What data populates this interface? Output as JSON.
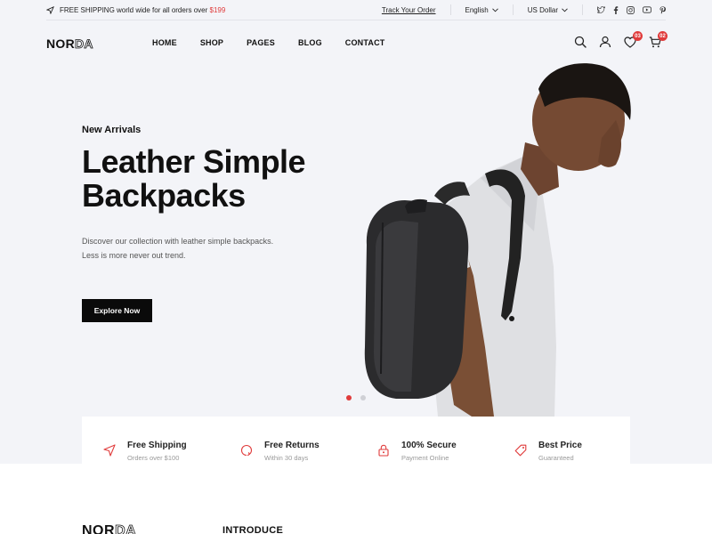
{
  "topbar": {
    "shipping_text": "FREE SHIPPING world wide for all orders over ",
    "shipping_amount": "$199",
    "track_order": "Track Your Order",
    "language": "English",
    "currency": "US Dollar",
    "socials": [
      "twitter-icon",
      "facebook-icon",
      "instagram-icon",
      "youtube-icon",
      "pinterest-icon"
    ]
  },
  "header": {
    "logo_solid": "NOR",
    "logo_outline": "DA",
    "nav": [
      "HOME",
      "SHOP",
      "PAGES",
      "BLOG",
      "CONTACT"
    ],
    "wishlist_count": "03",
    "cart_count": "02"
  },
  "hero": {
    "eyebrow": "New Arrivals",
    "headline_line1": "Leather Simple",
    "headline_line2": "Backpacks",
    "desc_line1": "Discover our collection with leather simple backpacks.",
    "desc_line2": "Less is more never out trend.",
    "cta_label": "Explore Now",
    "slides": 2,
    "active_slide": 1
  },
  "features": [
    {
      "title": "Free Shipping",
      "subtitle": "Orders over $100",
      "icon": "paper-plane-icon"
    },
    {
      "title": "Free Returns",
      "subtitle": "Within 30 days",
      "icon": "return-icon"
    },
    {
      "title": "100% Secure",
      "subtitle": "Payment Online",
      "icon": "lock-icon"
    },
    {
      "title": "Best Price",
      "subtitle": "Guaranteed",
      "icon": "price-tag-icon"
    }
  ],
  "footer": {
    "logo_solid": "NOR",
    "logo_outline": "DA",
    "heading": "INTRODUCE"
  },
  "colors": {
    "accent": "#e03b3b",
    "hero_bg": "#f3f4f8",
    "button_bg": "#0a0a0a"
  }
}
